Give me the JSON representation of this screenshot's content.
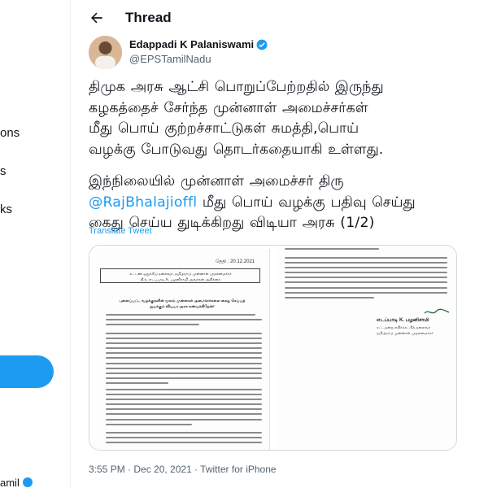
{
  "sidebar": {
    "fragments": [
      "ons",
      "s",
      "ks"
    ],
    "bottom_text": "amil"
  },
  "header": {
    "title": "Thread"
  },
  "author": {
    "name": "Edappadi K Palaniswami",
    "handle": "@EPSTamilNadu"
  },
  "tweet": {
    "para1_lines": [
      "திமுக அரசு ஆட்சி பொறுப்பேற்றதில் இருந்து",
      "கழகத்தைச் சேர்ந்த முன்னாள் அமைச்சர்கள்",
      "மீது பொய் குற்றச்சாட்டுகள் சுமத்தி,பொய்",
      "வழக்கு போடுவது தொடர்கதையாகி உள்ளது."
    ],
    "para2_line1": "இந்நிலையில் முன்னாள் அமைச்சர் திரு",
    "mention": "@RajBhalajioffl",
    "para2_line2_rest": " மீது பொய் வழக்கு பதிவு செய்து",
    "para2_line3": "கைது செய்ய துடிக்கிறது விடியா அரசு (1/2)",
    "translate": "Translate Tweet"
  },
  "media": {
    "doc_date": "தேதி : 20.12.2021",
    "doc_box_line1": "கட்டண ஒதுக்கீடு தலைவர், தமிழ்நாடு முன்னாள் முதலமைச்சர்",
    "doc_box_line2": "திரு. எடப்பாடி K. பழனிசாமி அவர்கள் அறிக்கை",
    "doc_heading": "புனைப்பட்ட வழக்குகளின் மூலம் முன்னாள் அமைச்சர்களை கைது செய்யத் துடிக்கும் விடியா அரசு கண்டிக்கிறேன்!",
    "sig_name": "எடப்பாடி K. பழனிசாமி",
    "sig_line1": "சட்டமன்ற எதிர்க்கட்சித் தலைவர்",
    "sig_line2": "தமிழ்நாடு முன்னாள் முதலமைச்சர்"
  },
  "timestamp": "3:55 PM · Dec 20, 2021 · Twitter for iPhone",
  "colors": {
    "accent": "#1d9bf0",
    "muted": "#536471",
    "text": "#0f1419"
  }
}
